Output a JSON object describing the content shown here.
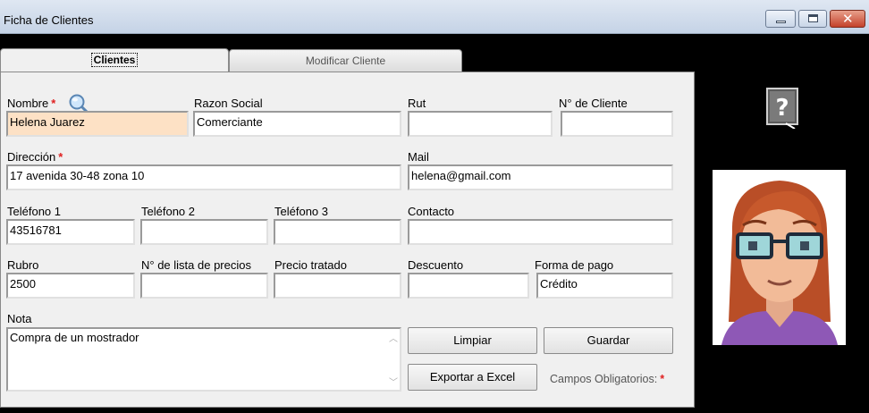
{
  "window": {
    "title": "Ficha de Clientes"
  },
  "tabs": [
    {
      "label": "Clientes",
      "active": true
    },
    {
      "label": "Modificar Cliente",
      "active": false
    }
  ],
  "form": {
    "nombre": {
      "label": "Nombre",
      "value": "Helena Juarez",
      "required": true
    },
    "razon_social": {
      "label": "Razon Social",
      "value": "Comerciante"
    },
    "rut": {
      "label": "Rut",
      "value": ""
    },
    "n_cliente": {
      "label": "N° de Cliente",
      "value": ""
    },
    "direccion": {
      "label": "Dirección",
      "value": "17 avenida 30-48 zona 10",
      "required": true
    },
    "mail": {
      "label": "Mail",
      "value": "helena@gmail.com"
    },
    "telefono1": {
      "label": "Teléfono 1",
      "value": "43516781"
    },
    "telefono2": {
      "label": "Teléfono 2",
      "value": ""
    },
    "telefono3": {
      "label": "Teléfono 3",
      "value": ""
    },
    "contacto": {
      "label": "Contacto",
      "value": ""
    },
    "rubro": {
      "label": "Rubro",
      "value": "2500"
    },
    "lista_precios": {
      "label": "N° de lista de precios",
      "value": ""
    },
    "precio_tratado": {
      "label": "Precio tratado",
      "value": ""
    },
    "descuento": {
      "label": "Descuento",
      "value": ""
    },
    "forma_pago": {
      "label": "Forma de pago",
      "value": "Crédito"
    },
    "nota": {
      "label": "Nota",
      "value": "Compra de un mostrador"
    },
    "required_mark": "*"
  },
  "buttons": {
    "limpiar": "Limpiar",
    "guardar": "Guardar",
    "exportar": "Exportar a Excel"
  },
  "footer": {
    "campos_obligatorios": "Campos Obligatorios:"
  },
  "colors": {
    "required": "#e02020",
    "highlight_field": "#fde1c5",
    "panel_bg": "#f0f0f0"
  },
  "icons": {
    "search": "magnifier-icon",
    "help": "help-icon",
    "avatar": "female-avatar"
  }
}
